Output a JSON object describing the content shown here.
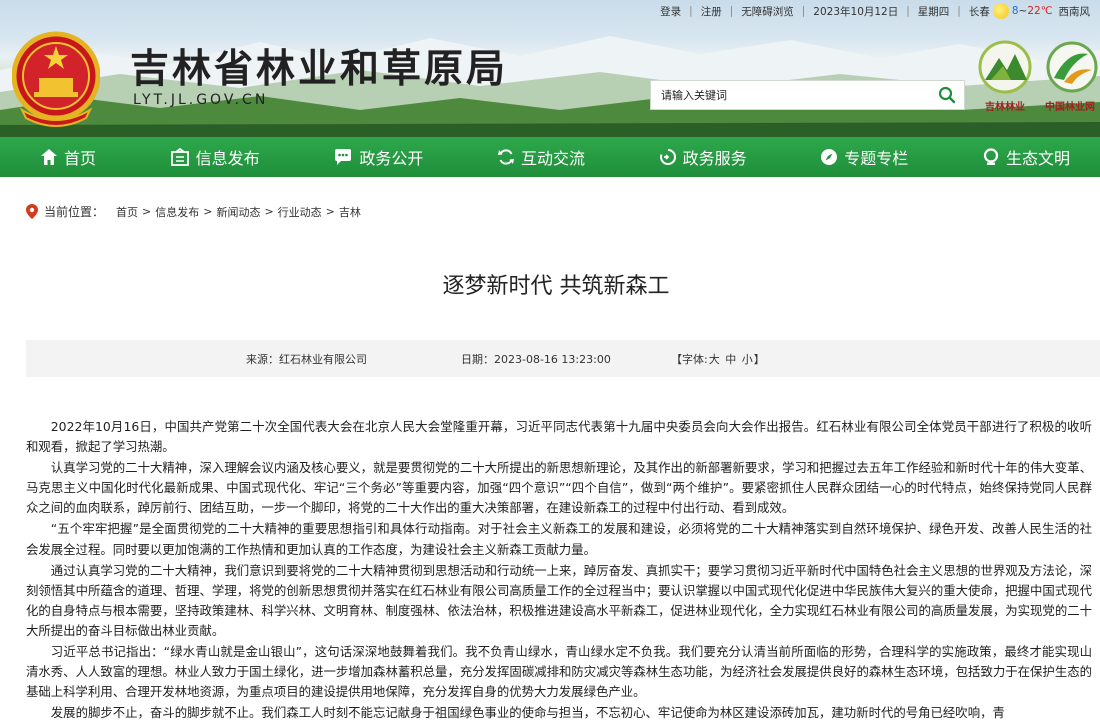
{
  "topbar": {
    "login": "登录",
    "register": "注册",
    "accessible": "无障碍浏览",
    "date": "2023年10月12日",
    "weekday": "星期四",
    "city": "长春",
    "temp_low": "8",
    "temp_sep": "~",
    "temp_high": "22℃",
    "wind": "西南风"
  },
  "header": {
    "title": "吉林省林业和草原局",
    "domain": "LYT.JL.GOV.CN",
    "search_placeholder": "请输入关键词",
    "logo1_text": "吉林林业",
    "logo2_text": "中国林业网"
  },
  "nav": [
    {
      "label": "首页",
      "icon": "home-icon"
    },
    {
      "label": "信息发布",
      "icon": "info-icon"
    },
    {
      "label": "政务公开",
      "icon": "chat-icon"
    },
    {
      "label": "互动交流",
      "icon": "refresh-icon"
    },
    {
      "label": "政务服务",
      "icon": "service-icon"
    },
    {
      "label": "专题专栏",
      "icon": "compass-icon"
    },
    {
      "label": "生态文明",
      "icon": "leaf-icon"
    }
  ],
  "breadcrumb": {
    "label": "当前位置：",
    "items": [
      "首页",
      "信息发布",
      "新闻动态",
      "行业动态",
      "吉林"
    ],
    "separator": ">"
  },
  "article": {
    "title": "逐梦新时代 共筑新森工",
    "source_label": "来源：",
    "source": "红石林业有限公司",
    "date_label": "日期：",
    "date": "2023-08-16 13:23:00",
    "font_prefix": "【字体:",
    "font_large": "大",
    "font_medium": "中",
    "font_small": "小",
    "font_suffix": "】",
    "paragraphs": [
      "2022年10月16日，中国共产党第二十次全国代表大会在北京人民大会堂隆重开幕，习近平同志代表第十九届中央委员会向大会作出报告。红石林业有限公司全体党员干部进行了积极的收听和观看，掀起了学习热潮。",
      "认真学习党的二十大精神，深入理解会议内涵及核心要义，就是要贯彻党的二十大所提出的新思想新理论，及其作出的新部署新要求，学习和把握过去五年工作经验和新时代十年的伟大变革、马克思主义中国化时代化最新成果、中国式现代化、牢记“三个务必”等重要内容，加强“四个意识”“四个自信”，做到“两个维护”。要紧密抓住人民群众团结一心的时代特点，始终保持党同人民群众之间的血肉联系，踔厉前行、团结互助，一步一个脚印，将党的二十大作出的重大决策部署，在建设新森工的过程中付出行动、看到成效。",
      "“五个牢牢把握”是全面贯彻党的二十大精神的重要思想指引和具体行动指南。对于社会主义新森工的发展和建设，必须将党的二十大精神落实到自然环境保护、绿色开发、改善人民生活的社会发展全过程。同时要以更加饱满的工作热情和更加认真的工作态度，为建设社会主义新森工贡献力量。",
      "通过认真学习党的二十大精神，我们意识到要将党的二十大精神贯彻到思想活动和行动统一上来，踔厉奋发、真抓实干；要学习贯彻习近平新时代中国特色社会主义思想的世界观及方法论，深刻领悟其中所蕴含的道理、哲理、学理，将党的创新思想贯彻并落实在红石林业有限公司高质量工作的全过程当中；要认识掌握以中国式现代化促进中华民族伟大复兴的重大使命，把握中国式现代化的自身特点与根本需要，坚持政策建林、科学兴林、文明育林、制度强林、依法治林，积极推进建设高水平新森工，促进林业现代化，全力实现红石林业有限公司的高质量发展，为实现党的二十大所提出的奋斗目标做出林业贡献。",
      "习近平总书记指出：“绿水青山就是金山银山”，这句话深深地鼓舞着我们。我不负青山绿水，青山绿水定不负我。我们要充分认清当前所面临的形势，合理科学的实施政策，最终才能实现山清水秀、人人致富的理想。林业人致力于国土绿化，进一步增加森林蓄积总量，充分发挥固碳减排和防灾减灾等森林生态功能，为经济社会发展提供良好的森林生态环境，包括致力于在保护生态的基础上科学利用、合理开发林地资源，为重点项目的建设提供用地保障，充分发挥自身的优势大力发展绿色产业。",
      "发展的脚步不止，奋斗的脚步就不止。我们森工人时刻不能忘记献身于祖国绿色事业的使命与担当，不忘初心、牢记使命为林区建设添砖加瓦，建功新时代的号角已经吹响，青"
    ]
  }
}
